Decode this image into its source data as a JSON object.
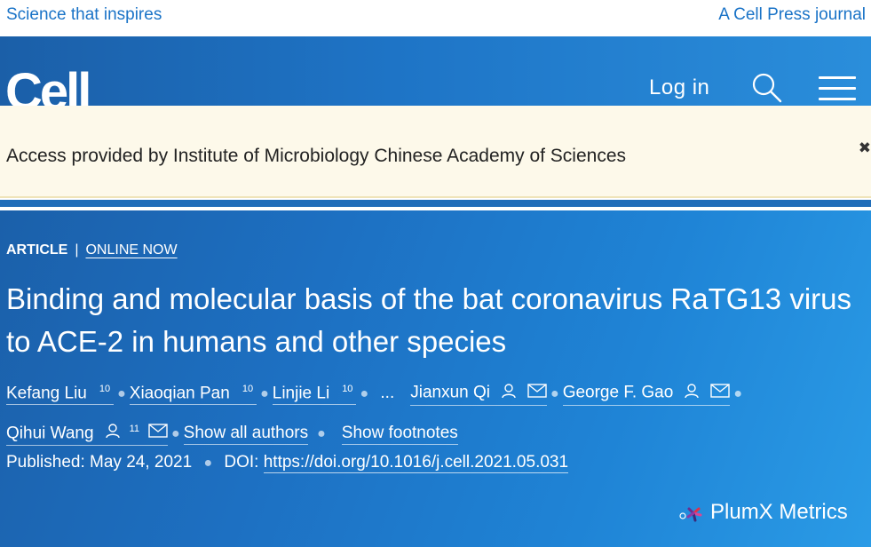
{
  "topbar": {
    "tagline": "Science that inspires",
    "journal": "A Cell Press journal"
  },
  "header": {
    "logo": "Cell",
    "login": "Log in"
  },
  "access": {
    "text": "Access provided by Institute of Microbiology Chinese Academy of Sciences",
    "close": "✖"
  },
  "article": {
    "type": "ARTICLE",
    "separator": "|",
    "status": "ONLINE NOW",
    "title": "Binding and molecular basis of the bat coronavirus RaTG13 virus to ACE-2 in humans and other species",
    "authors": [
      {
        "name": "Kefang Liu",
        "sup": "10"
      },
      {
        "name": "Xiaoqian Pan",
        "sup": "10"
      },
      {
        "name": "Linjie Li",
        "sup": "10"
      },
      {
        "name": "Jianxun Qi"
      },
      {
        "name": "George F. Gao"
      },
      {
        "name": "Qihui Wang",
        "sup": "11"
      }
    ],
    "ellipsis": "...",
    "show_all": "Show all authors",
    "show_footnotes": "Show footnotes",
    "published_label": "Published:",
    "published_date": "May 24, 2021",
    "doi_label": "DOI:",
    "doi": "https://doi.org/10.1016/j.cell.2021.05.031"
  },
  "plumx": {
    "label": "PlumX Metrics"
  }
}
